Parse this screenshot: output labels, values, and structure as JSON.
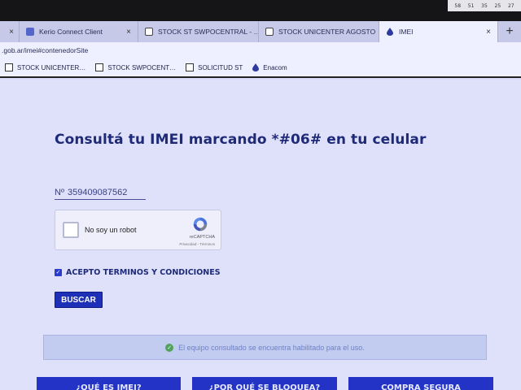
{
  "bezel": {
    "readout": [
      "58",
      "51",
      "35",
      "25",
      "27"
    ]
  },
  "tabs": [
    {
      "label": "",
      "icon": "close-icon",
      "active": false
    },
    {
      "label": "Kerio Connect Client",
      "icon": "kerio-icon",
      "active": false
    },
    {
      "label": "STOCK ST SWPOCENTRAL - …",
      "icon": "doc-icon",
      "active": false
    },
    {
      "label": "STOCK UNICENTER AGOSTO",
      "icon": "doc-icon",
      "active": false
    },
    {
      "label": "IMEI",
      "icon": "enacom-icon",
      "active": true
    }
  ],
  "tab_close": "×",
  "new_tab": "+",
  "address": {
    "url": ".gob.ar/imei#contenedorSite"
  },
  "bookmarks": [
    {
      "label": "STOCK UNICENTER…",
      "icon": "doc-icon"
    },
    {
      "label": "STOCK SWPOCENT…",
      "icon": "doc-icon"
    },
    {
      "label": "SOLICITUD ST",
      "icon": "doc-icon"
    },
    {
      "label": "Enacom",
      "icon": "enacom-icon"
    }
  ],
  "page": {
    "title": "Consultá tu IMEI marcando *#06# en tu celular",
    "imei": {
      "prefix": "Nº",
      "value": "359409087562"
    },
    "recaptcha": {
      "label": "No soy un robot",
      "brand": "reCAPTCHA",
      "links": "Privacidad - Términos"
    },
    "terms_label": "ACEPTO TERMINOS Y CONDICIONES",
    "terms_checked": true,
    "search_button": "BUSCAR",
    "result_message": "El equipo consultado se encuentra habilitado para el uso.",
    "bottom_buttons": [
      "¿QUÉ ES IMEI?",
      "¿POR QUÉ SE BLOQUEA?",
      "COMPRA SEGURA"
    ]
  },
  "colors": {
    "primary_button": "#1e2fb8",
    "title": "#1e2a78",
    "success": "#4fa35a"
  }
}
